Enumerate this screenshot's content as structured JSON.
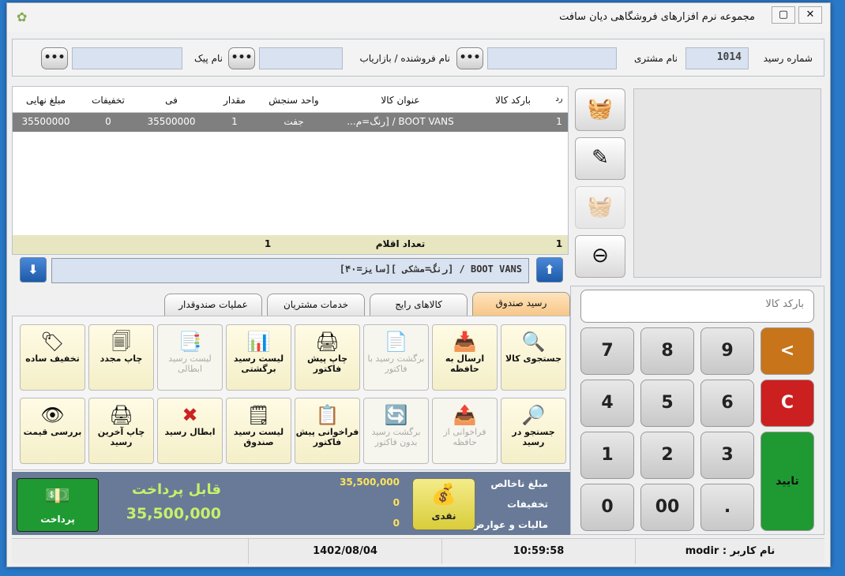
{
  "window": {
    "title": "مجموعه نرم افزارهای فروشگاهی دیان سافت"
  },
  "header": {
    "receipt_label": "شماره رسید",
    "receipt_value": "1014",
    "customer_label": "نام مشتری",
    "customer_value": "",
    "seller_label": "نام فروشنده / بازاریاب",
    "seller_value": "",
    "courier_label": "نام پیک",
    "courier_value": "",
    "dots": "•••"
  },
  "grid": {
    "columns": [
      "رد",
      "بارکد کالا",
      "عنوان کالا",
      "واحد سنجش",
      "مقدار",
      "فی",
      "تخفیفات",
      "مبلغ نهایی"
    ],
    "rows": [
      [
        "1",
        "",
        "BOOT VANS / [رنگ=م...",
        "جفت",
        "1",
        "35500000",
        "0",
        "35500000"
      ]
    ],
    "footer": {
      "count_left": "1",
      "label": "تعداد اقلام",
      "count_right": "1"
    }
  },
  "nav": {
    "text": "BOOT VANS / [رنگ=مشکی ][سایز=۴۰]",
    "up": "⬆",
    "down": "⬇"
  },
  "tabs": [
    "رسید صندوق",
    "کالاهای رایج",
    "خدمات مشتریان",
    "عملیات صندوقدار"
  ],
  "buttons": {
    "row1": [
      {
        "label": "جستجوی کالا",
        "icon": "🔍"
      },
      {
        "label": "ارسال به حافظه",
        "icon": "📥"
      },
      {
        "label": "برگشت رسید با فاکتور",
        "icon": "📄"
      },
      {
        "label": "چاپ پیش فاکتور",
        "icon": "🖨"
      },
      {
        "label": "لیست رسید برگشتی",
        "icon": "📊"
      },
      {
        "label": "لیست رسید ابطالی",
        "icon": "📑"
      },
      {
        "label": "چاپ مجدد",
        "icon": "🗐"
      },
      {
        "label": "تخفیف ساده",
        "icon": "🏷"
      }
    ],
    "row2": [
      {
        "label": "جستجو در رسید",
        "icon": "🔎"
      },
      {
        "label": "فراخوانی از حافظه",
        "icon": "📤"
      },
      {
        "label": "برگشت رسید بدون فاکتور",
        "icon": "🔄"
      },
      {
        "label": "فراخوانی پیش فاکتور",
        "icon": "📋"
      },
      {
        "label": "لیست رسید صندوق",
        "icon": "🗒"
      },
      {
        "label": "ابطال رسید",
        "icon": "✖"
      },
      {
        "label": "چاپ آخرین رسید",
        "icon": "🖨"
      },
      {
        "label": "بررسی قیمت",
        "icon": "👁"
      }
    ]
  },
  "payment": {
    "gross_label": "مبلغ ناخالص",
    "gross_value": "35,500,000",
    "discount_label": "تخفیفات",
    "discount_value": "0",
    "tax_label": "مالیات و عوارض",
    "tax_value": "0",
    "cash_label": "نقدی",
    "payable_label": "قابل پرداخت",
    "payable_value": "35,500,000",
    "pay_label": "پرداخت"
  },
  "keypad": {
    "barcode_placeholder": "بارکد کالا",
    "keys": [
      "7",
      "8",
      "9",
      "<",
      "4",
      "5",
      "6",
      "C",
      "1",
      "2",
      "3",
      "0",
      "00",
      "."
    ],
    "confirm": "تایید"
  },
  "status": {
    "user": "modir : نام کاربر",
    "time": "10:59:58",
    "date": "1402/08/04"
  },
  "colors": {
    "back_key": "#c8741a",
    "clear_key": "#cc1f1f",
    "confirm_key": "#1f9a32",
    "pay_button": "#1f9a32",
    "payable_text": "#c8f06a"
  }
}
